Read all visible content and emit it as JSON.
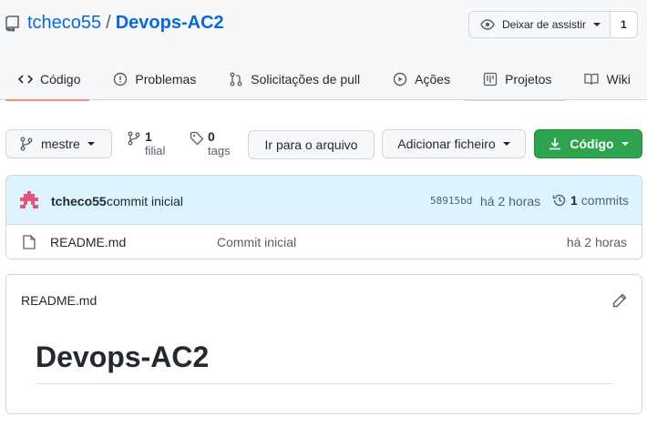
{
  "repo": {
    "owner": "tcheco55",
    "separator": "/",
    "name": "Devops-AC2"
  },
  "watch": {
    "label": "Deixar de assistir",
    "count": "1"
  },
  "tabs": [
    {
      "label": "Código",
      "icon": "code-icon",
      "active": true
    },
    {
      "label": "Problemas",
      "icon": "issue-icon"
    },
    {
      "label": "Solicitações de pull",
      "icon": "pull-request-icon"
    },
    {
      "label": "Ações",
      "icon": "play-icon"
    },
    {
      "label": "Projetos",
      "icon": "project-icon"
    },
    {
      "label": "Wiki",
      "icon": "book-icon"
    }
  ],
  "toolbar": {
    "branch": "mestre",
    "branches_count": "1",
    "branches_label": "filial",
    "tags_count": "0",
    "tags_label": "tags",
    "goto_file": "Ir para o arquivo",
    "add_file": "Adicionar ficheiro",
    "code": "Código"
  },
  "commit": {
    "author": "tcheco55",
    "message": "commit inicial",
    "sha": "58915bd",
    "time": "há 2 horas",
    "count": "1",
    "count_label": "commits"
  },
  "files": [
    {
      "name": "README.md",
      "message": "Commit inicial",
      "time": "há 2 horas"
    }
  ],
  "readme": {
    "filename": "README.md",
    "heading": "Devops-AC2"
  },
  "colors": {
    "accent": "#0969da",
    "primary_button": "#2da44e",
    "tab_underline": "#fd8c73",
    "commit_header_bg": "#ddf4ff"
  }
}
